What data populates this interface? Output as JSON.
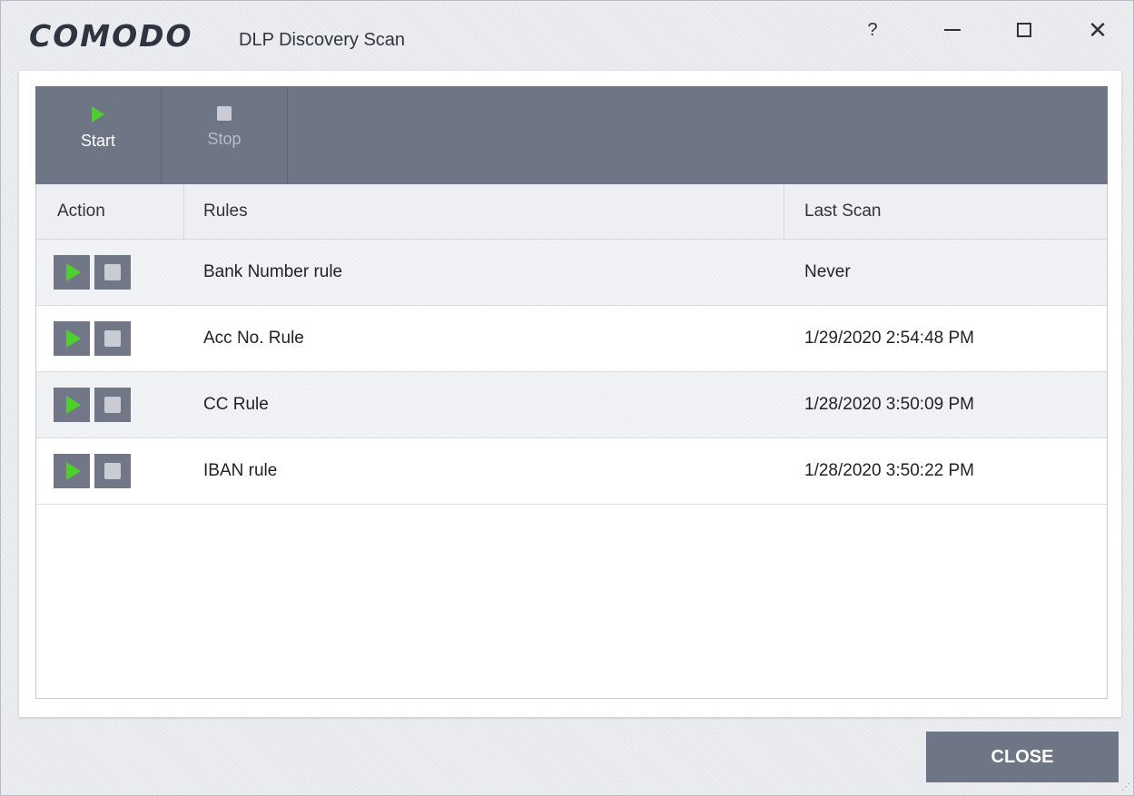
{
  "window": {
    "brand": "COMODO",
    "title": "DLP Discovery Scan",
    "help_label": "?",
    "close_glyph": "✕"
  },
  "toolbar": {
    "start_label": "Start",
    "stop_label": "Stop"
  },
  "table": {
    "columns": [
      "Action",
      "Rules",
      "Last Scan"
    ],
    "rows": [
      {
        "rule": "Bank Number rule",
        "last_scan": "Never"
      },
      {
        "rule": "Acc No. Rule",
        "last_scan": "1/29/2020 2:54:48 PM"
      },
      {
        "rule": "CC Rule",
        "last_scan": "1/28/2020 3:50:09 PM"
      },
      {
        "rule": "IBAN rule",
        "last_scan": "1/28/2020 3:50:22 PM"
      }
    ]
  },
  "footer": {
    "close_label": "CLOSE"
  },
  "colors": {
    "toolbar_bg": "#6e7585",
    "play_green": "#4cd12b",
    "button_gray": "#717787"
  },
  "icons": [
    "play-icon",
    "stop-icon",
    "help-icon",
    "minimize-icon",
    "maximize-icon",
    "close-icon",
    "resize-grip-icon"
  ]
}
